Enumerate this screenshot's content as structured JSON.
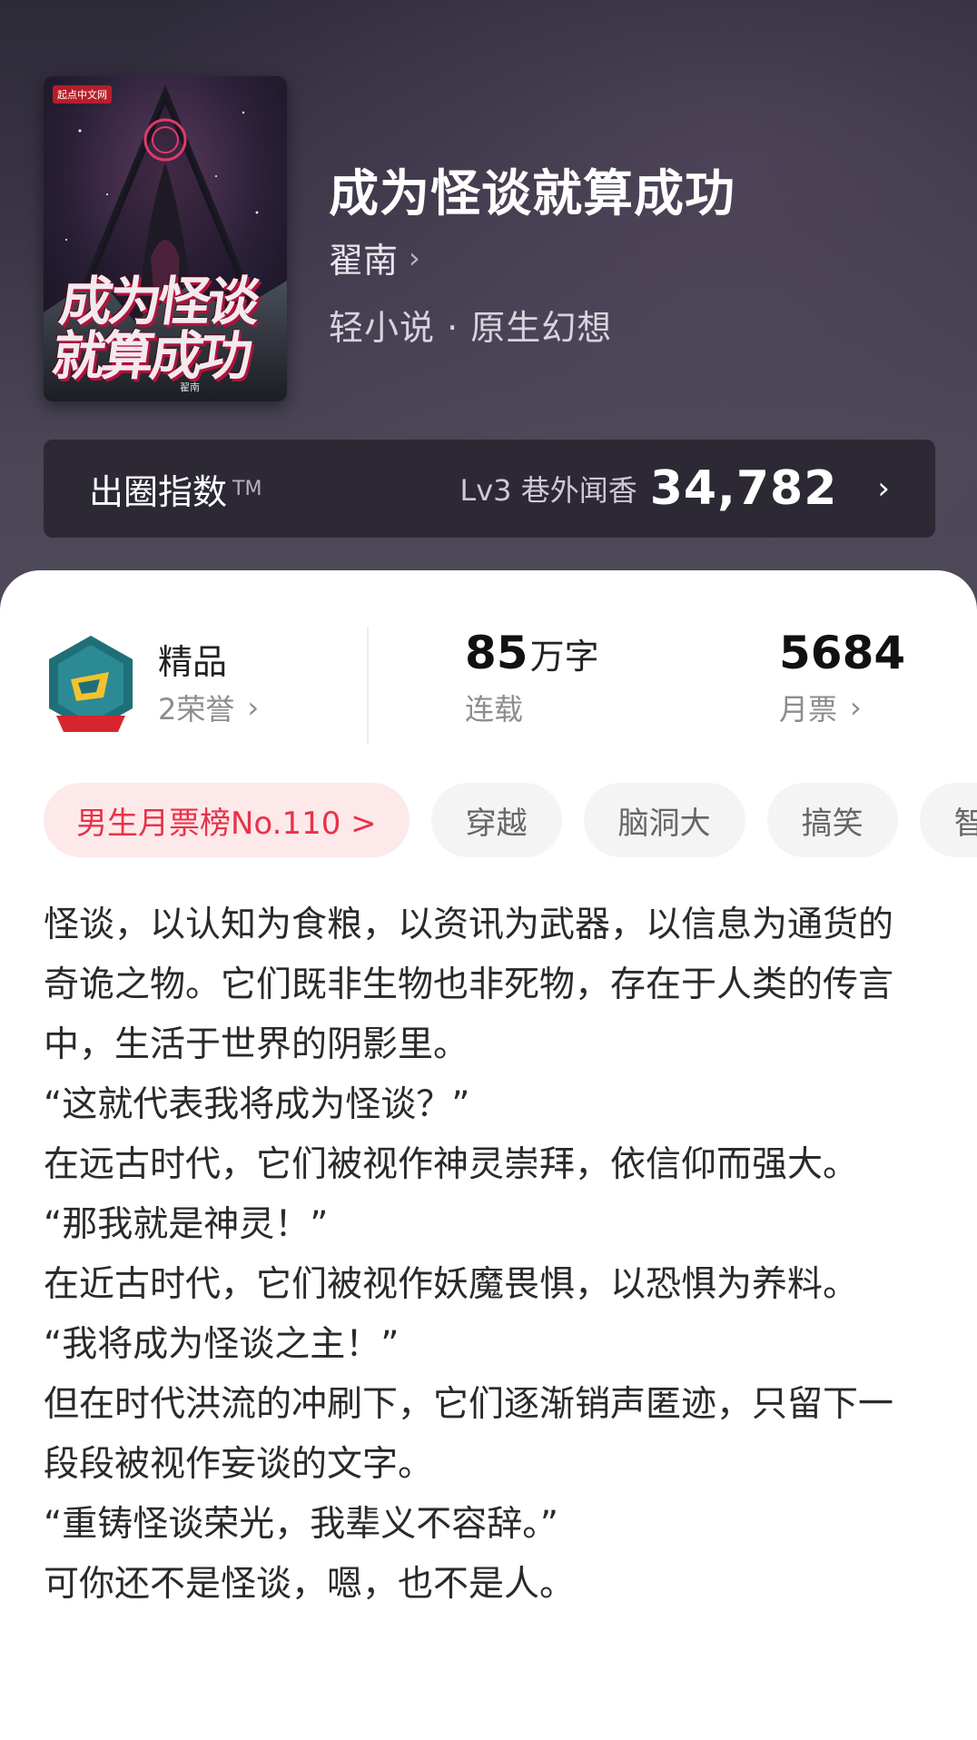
{
  "book": {
    "title": "成为怪谈就算成功",
    "author": "翟南",
    "genre": "轻小说 · 原生幻想",
    "cover": {
      "publisher": "起点中文网",
      "title_art": "成为怪谈就算成功",
      "author_tag": "翟南"
    }
  },
  "index_bar": {
    "label": "出圈指数",
    "tm": "TM",
    "level": "Lv3 巷外闻香",
    "value": "34,782"
  },
  "stats": {
    "honor": {
      "title": "精品",
      "sub": "2荣誉"
    },
    "words": {
      "num": "85",
      "unit": "万字",
      "sub": "连载"
    },
    "tickets": {
      "num": "5684",
      "sub": "月票"
    }
  },
  "tags": [
    "男生月票榜No.110 >",
    "穿越",
    "脑洞大",
    "搞笑",
    "智"
  ],
  "intro": [
    "怪谈，以认知为食粮，以资讯为武器，以信息为通货的奇诡之物。它们既非生物也非死物，存在于人类的传言中，生活于世界的阴影里。",
    "“这就代表我将成为怪谈？”",
    "在远古时代，它们被视作神灵崇拜，依信仰而强大。",
    "“那我就是神灵！”",
    "在近古时代，它们被视作妖魔畏惧，以恐惧为养料。",
    "“我将成为怪谈之主！”",
    "但在时代洪流的冲刷下，它们逐渐销声匿迹，只留下一段段被视作妄谈的文字。",
    "“重铸怪谈荣光，我辈义不容辞。”",
    "可你还不是怪谈，嗯，也不是人。"
  ]
}
